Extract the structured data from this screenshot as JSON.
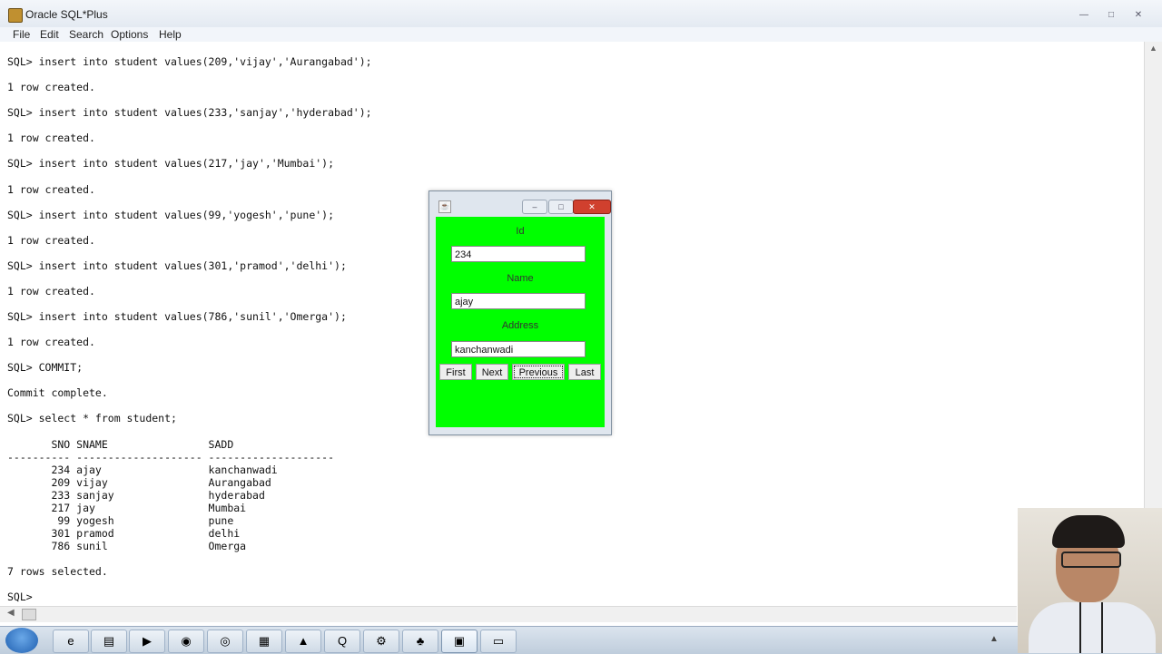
{
  "window": {
    "title": "Oracle SQL*Plus",
    "controls": {
      "minimize": "—",
      "maximize": "□",
      "close": "✕"
    }
  },
  "menu": [
    "File",
    "Edit",
    "Search",
    "Options",
    "Help"
  ],
  "console_lines": [
    "SQL> insert into student values(209,'vijay','Aurangabad');",
    "",
    "1 row created.",
    "",
    "SQL> insert into student values(233,'sanjay','hyderabad');",
    "",
    "1 row created.",
    "",
    "SQL> insert into student values(217,'jay','Mumbai');",
    "",
    "1 row created.",
    "",
    "SQL> insert into student values(99,'yogesh','pune');",
    "",
    "1 row created.",
    "",
    "SQL> insert into student values(301,'pramod','delhi');",
    "",
    "1 row created.",
    "",
    "SQL> insert into student values(786,'sunil','Omerga');",
    "",
    "1 row created.",
    "",
    "SQL> COMMIT;",
    "",
    "Commit complete.",
    "",
    "SQL> select * from student;",
    "",
    "       SNO SNAME                SADD",
    "---------- -------------------- --------------------",
    "       234 ajay                 kanchanwadi",
    "       209 vijay                Aurangabad",
    "       233 sanjay               hyderabad",
    "       217 jay                  Mumbai",
    "        99 yogesh               pune",
    "       301 pramod               delhi",
    "       786 sunil                Omerga",
    "",
    "7 rows selected.",
    "",
    "SQL>"
  ],
  "dialog": {
    "icon": "java-icon",
    "id_label": "Id",
    "id_value": "234",
    "name_label": "Name",
    "name_value": "ajay",
    "address_label": "Address",
    "address_value": "kanchanwadi",
    "buttons": {
      "first": "First",
      "next": "Next",
      "previous": "Previous",
      "last": "Last"
    },
    "background": "#00ff00"
  },
  "taskbar": {
    "items": [
      {
        "icon": "ie-icon",
        "glyph": "e"
      },
      {
        "icon": "folder-icon",
        "glyph": "▤"
      },
      {
        "icon": "media-player-icon",
        "glyph": "▶"
      },
      {
        "icon": "firefox-icon",
        "glyph": "◉"
      },
      {
        "icon": "chrome-icon",
        "glyph": "◎"
      },
      {
        "icon": "file-manager-icon",
        "glyph": "▦"
      },
      {
        "icon": "sql-plus-icon",
        "glyph": "▲"
      },
      {
        "icon": "app-q-icon",
        "glyph": "Q"
      },
      {
        "icon": "tools-icon",
        "glyph": "⚙"
      },
      {
        "icon": "java-icon",
        "glyph": "♣"
      },
      {
        "icon": "cmd-icon",
        "glyph": "▣"
      },
      {
        "icon": "document-icon",
        "glyph": "▭"
      }
    ]
  }
}
